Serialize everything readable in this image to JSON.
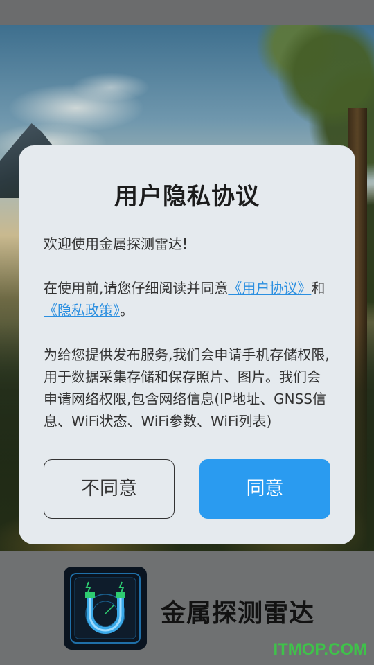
{
  "dialog": {
    "title": "用户隐私协议",
    "greeting": "欢迎使用金属探测雷达!",
    "intro_prefix": "在使用前,请您仔细阅读并同意",
    "user_agreement_link": "《用户协议》",
    "and_text": "和",
    "privacy_policy_link": "《隐私政策》",
    "intro_suffix": "。",
    "permissions_text": "为给您提供发布服务,我们会申请手机存储权限, 用于数据采集存储和保存照片、图片。我们会申请网络权限,包含网络信息(IP地址、GNSS信息、WiFi状态、WiFi参数、WiFi列表)",
    "disagree_label": "不同意",
    "agree_label": "同意"
  },
  "splash": {
    "app_name": "金属探测雷达",
    "app_icon": "magnet-radar-icon"
  },
  "watermark": "ITMOP.COM",
  "colors": {
    "agree_button": "#2a9bf0",
    "link": "#2b8fe0",
    "dialog_bg": "#e5eaee"
  }
}
